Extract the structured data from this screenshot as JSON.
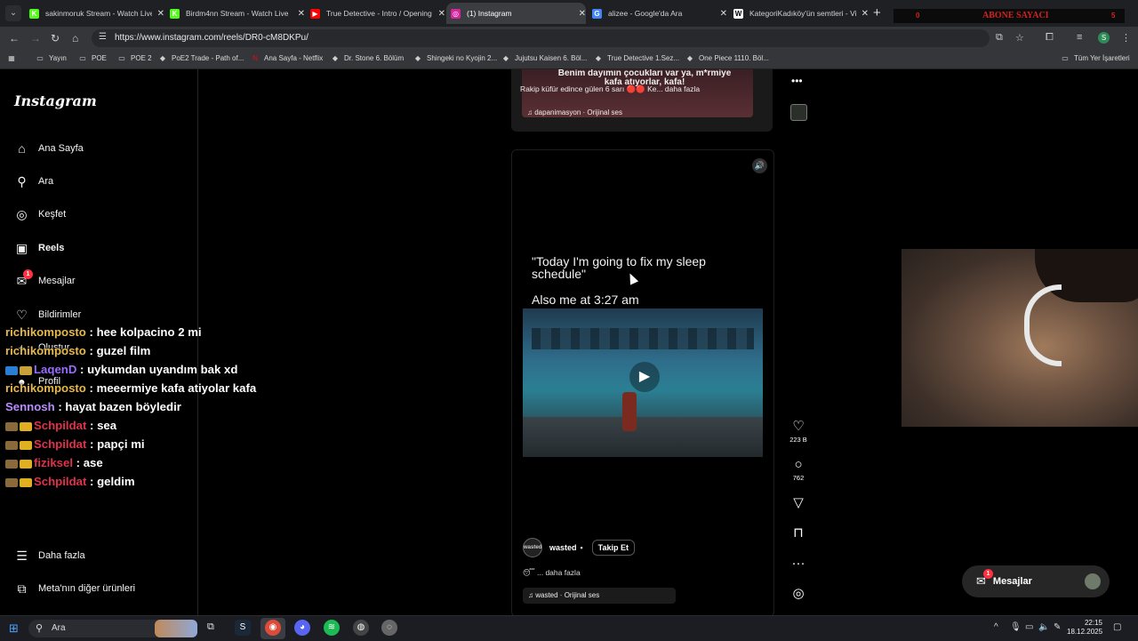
{
  "browser": {
    "tabs": [
      {
        "title": "sakinmoruk Stream - Watch Live",
        "favicon": "kick-icon",
        "color": "#53fc18",
        "glyph": "K"
      },
      {
        "title": "Birdm4nn Stream - Watch Live",
        "favicon": "kick-icon",
        "color": "#53fc18",
        "glyph": "K"
      },
      {
        "title": "True Detective - Intro / Opening",
        "favicon": "youtube-icon",
        "color": "#ff0000",
        "glyph": "▶"
      },
      {
        "title": "(1) Instagram",
        "favicon": "instagram-icon",
        "color": "#d6249f",
        "glyph": "◎"
      },
      {
        "title": "alizee - Google'da Ara",
        "favicon": "google-icon",
        "color": "#4285f4",
        "glyph": "G"
      },
      {
        "title": "KategoriKadıköy'ün semtleri - Vikipedi",
        "favicon": "wikipedia-icon",
        "color": "#ffffff",
        "glyph": "W"
      }
    ],
    "active_tab": 3,
    "overlay": {
      "left_count": "0",
      "label": "ABONE SAYACI",
      "right_count": "5"
    },
    "url": "https://www.instagram.com/reels/DR0-cM8DKPu/",
    "profile_initial": "S",
    "bookmarks": [
      {
        "label": "Yayın",
        "icon": "folder-icon"
      },
      {
        "label": "POE",
        "icon": "folder-icon"
      },
      {
        "label": "POE 2",
        "icon": "folder-icon"
      },
      {
        "label": "PoE2 Trade - Path of...",
        "icon": "poe-trade-icon"
      },
      {
        "label": "Ana Sayfa - Netflix",
        "icon": "netflix-icon"
      },
      {
        "label": "Dr. Stone 6. Bölüm",
        "icon": "anime-site-icon"
      },
      {
        "label": "Shingeki no Kyojin 2...",
        "icon": "anime-site-icon"
      },
      {
        "label": "Jujutsu Kaisen 6. Böl...",
        "icon": "jjk-icon"
      },
      {
        "label": "True Detective 1.Sez...",
        "icon": "dizi-site-icon"
      },
      {
        "label": "One Piece 1110. Böl...",
        "icon": "anime-site-icon"
      }
    ],
    "all_bookmarks": "Tüm Yer İşaretleri"
  },
  "sidebar": {
    "logo": "Instagram",
    "items": [
      {
        "label": "Ana Sayfa",
        "icon": "home-icon",
        "glyph": "⌂"
      },
      {
        "label": "Ara",
        "icon": "search-icon",
        "glyph": "⚲"
      },
      {
        "label": "Keşfet",
        "icon": "compass-icon",
        "glyph": "◎"
      },
      {
        "label": "Reels",
        "icon": "reels-icon",
        "glyph": "▣"
      },
      {
        "label": "Mesajlar",
        "icon": "messenger-icon",
        "glyph": "✉",
        "badge": "1"
      },
      {
        "label": "Bildirimler",
        "icon": "heart-icon",
        "glyph": "♡"
      },
      {
        "label": "Oluştur",
        "icon": "plus-icon",
        "glyph": "+"
      },
      {
        "label": "Profil",
        "icon": "avatar-icon",
        "glyph": "●"
      }
    ],
    "more": "Daha fazla",
    "meta": "Meta'nın diğer ürünleri"
  },
  "prev_reel": {
    "caption_overlay": "Benim dayımın çocukları var ya, m*rmiye kafa atıyorlar, kafa!",
    "caption": "Rakip küfür edince gülen 6 sarı 🔴🔴 Ke... daha fazla",
    "audio": "dapanimasyon · Orijinal ses"
  },
  "reel": {
    "quote": "\"Today I'm going to fix my sleep schedule\"",
    "also": "Also me at 3:27 am",
    "author": "wasted",
    "author_avatar_text": "wasted",
    "follow": "Takip Et",
    "desc": "... daha fazla",
    "audio": "wasted · Orijinal ses",
    "likes": "223 B",
    "comments": "762"
  },
  "chat": [
    {
      "user": "richikomposto",
      "msg": "hee kolpacino 2 mi",
      "color": "#e6b84a",
      "badges": []
    },
    {
      "user": "richikomposto",
      "msg": "guzel film",
      "color": "#e6b84a",
      "badges": []
    },
    {
      "user": "LaqenD",
      "msg": "uykumdan uyandım bak xd",
      "color": "#9a6bff",
      "badges": [
        "#2a7fd4",
        "#c9a13a"
      ]
    },
    {
      "user": "richikomposto",
      "msg": "meeermiye kafa atiyolar kafa",
      "color": "#e6b84a",
      "badges": []
    },
    {
      "user": "Sennosh",
      "msg": "hayat bazen böyledir",
      "color": "#b78cff",
      "badges": []
    },
    {
      "user": "Schpildat",
      "msg": "sea",
      "color": "#e0324a",
      "badges": [
        "#8a6a3a",
        "#e0b020"
      ]
    },
    {
      "user": "Schpildat",
      "msg": "papçi mi",
      "color": "#e0324a",
      "badges": [
        "#8a6a3a",
        "#e0b020"
      ]
    },
    {
      "user": "fiziksel",
      "msg": "ase",
      "color": "#e0324a",
      "badges": [
        "#8a6a3a",
        "#e0b020"
      ]
    },
    {
      "user": "Schpildat",
      "msg": "geldim",
      "color": "#e0324a",
      "badges": [
        "#8a6a3a",
        "#e0b020"
      ]
    }
  ],
  "messages_pill": {
    "label": "Mesajlar",
    "badge": "1"
  },
  "taskbar": {
    "search": "Ara",
    "time": "22:15",
    "date": "18.12.2025"
  }
}
